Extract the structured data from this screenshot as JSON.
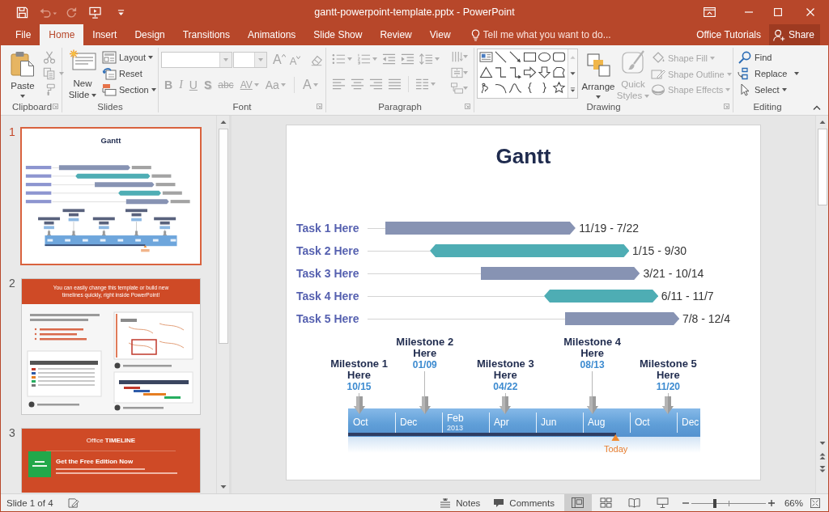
{
  "window": {
    "title": "gantt-powerpoint-template.pptx - PowerPoint"
  },
  "quick_access": [
    {
      "disabled": false
    },
    {
      "disabled": true
    },
    {
      "disabled": true
    },
    {
      "disabled": false
    }
  ],
  "tabs": [
    {
      "label": "File",
      "selected": false
    },
    {
      "label": "Home",
      "selected": true
    },
    {
      "label": "Insert",
      "selected": false
    },
    {
      "label": "Design",
      "selected": false
    },
    {
      "label": "Transitions",
      "selected": false
    },
    {
      "label": "Animations",
      "selected": false
    },
    {
      "label": "Slide Show",
      "selected": false
    },
    {
      "label": "Review",
      "selected": false
    },
    {
      "label": "View",
      "selected": false
    }
  ],
  "tell_me": {
    "placeholder": "Tell me what you want to do..."
  },
  "account": {
    "name": "Office Tutorials"
  },
  "share": {
    "label": "Share"
  },
  "ribbon": {
    "clipboard": {
      "label": "Clipboard",
      "paste": "Paste",
      "tools_disabled": true
    },
    "slides": {
      "label": "Slides",
      "new_slide": "New Slide",
      "items": [
        {
          "label": "Layout",
          "dropdown": true
        },
        {
          "label": "Reset",
          "dropdown": false
        },
        {
          "label": "Section",
          "dropdown": true
        }
      ]
    },
    "font": {
      "label": "Font",
      "disabled": true,
      "size_buttons": [
        {
          "label": "A"
        },
        {
          "label": "A"
        }
      ],
      "format_buttons": [
        {
          "label": "B",
          "kind": "bold",
          "dropdown": false
        },
        {
          "label": "I",
          "kind": "italic",
          "dropdown": false
        },
        {
          "label": "U",
          "kind": "underline",
          "dropdown": false
        },
        {
          "label": "S",
          "kind": "shadow",
          "dropdown": false
        },
        {
          "label": "abc",
          "kind": "strikethrough",
          "dropdown": false
        },
        {
          "label": "AV",
          "kind": "spacing",
          "dropdown": true
        },
        {
          "label": "Aa",
          "kind": "case",
          "dropdown": true
        },
        {
          "label": "A",
          "kind": "color",
          "dropdown": true
        }
      ]
    },
    "paragraph": {
      "label": "Paragraph",
      "disabled": true
    },
    "drawing": {
      "label": "Drawing",
      "arrange": "Arrange",
      "quick_styles": {
        "label": "Quick Styles",
        "disabled": true
      },
      "shape_items": [
        {
          "label": "Shape Fill",
          "disabled": true
        },
        {
          "label": "Shape Outline",
          "disabled": true
        },
        {
          "label": "Shape Effects",
          "disabled": true
        }
      ]
    },
    "editing": {
      "label": "Editing",
      "items": [
        {
          "label": "Find",
          "dropdown": false
        },
        {
          "label": "Replace",
          "dropdown": true
        },
        {
          "label": "Select",
          "dropdown": true
        }
      ]
    }
  },
  "thumbnails": [
    {
      "number": "1",
      "selected": true,
      "kind": "gantt",
      "title": "Gantt"
    },
    {
      "number": "2",
      "selected": false,
      "kind": "promo",
      "headline": "You can easily change this template or build new timelines quickly, right inside PowerPoint!"
    },
    {
      "number": "3",
      "selected": false,
      "kind": "download",
      "logo": "Office **TIMELINE**",
      "headline": "Get the Free Edition Now"
    }
  ],
  "slide": {
    "title": "Gantt",
    "tasks": [
      {
        "label": "Task 1 Here",
        "dates": "11/19 - 7/22",
        "kind": "single",
        "color": "#8793b3"
      },
      {
        "label": "Task 2 Here",
        "dates": "1/15 - 9/30",
        "kind": "double",
        "color": "#4eadb4"
      },
      {
        "label": "Task 3 Here",
        "dates": "3/21 - 10/14",
        "kind": "single",
        "color": "#8793b3"
      },
      {
        "label": "Task 4 Here",
        "dates": "6/11 - 11/7",
        "kind": "double",
        "color": "#4eadb4"
      },
      {
        "label": "Task 5 Here",
        "dates": "7/8 - 12/4",
        "kind": "single",
        "color": "#8793b3"
      }
    ],
    "timeline": {
      "months": [
        {
          "label": "Oct"
        },
        {
          "label": "Dec"
        },
        {
          "label": "Feb",
          "year": "2013"
        },
        {
          "label": "Apr"
        },
        {
          "label": "Jun"
        },
        {
          "label": "Aug"
        },
        {
          "label": "Oct"
        },
        {
          "label": "Dec"
        }
      ],
      "level": 0.76,
      "today": "Today",
      "milestones": [
        {
          "title": "Milestone 1 Here",
          "date": "10/15"
        },
        {
          "title": "Milestone 2 Here",
          "date": "01/09"
        },
        {
          "title": "Milestone 3 Here",
          "date": "04/22"
        },
        {
          "title": "Milestone 4 Here",
          "date": "08/13"
        },
        {
          "title": "Milestone 5 Here",
          "date": "11/20"
        }
      ]
    }
  },
  "status_bar": {
    "slide_info": "Slide 1 of 4",
    "notes": "Notes",
    "comments": "Comments",
    "views": [
      {
        "selected": true
      },
      {
        "selected": false
      },
      {
        "selected": false
      },
      {
        "selected": false
      }
    ],
    "zoom": {
      "level": 0.32,
      "reading": "66%"
    }
  }
}
